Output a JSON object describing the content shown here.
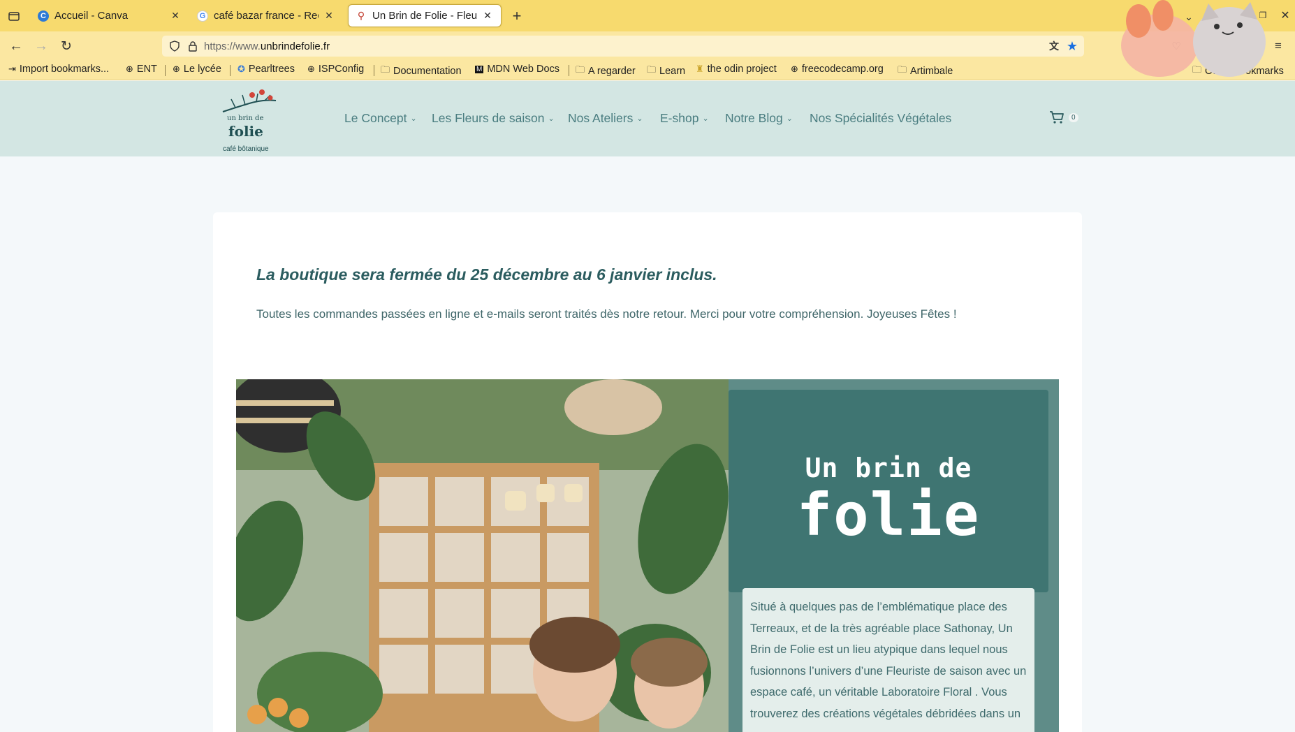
{
  "browser": {
    "tabs": [
      {
        "title": "Accueil - Canva",
        "active": false
      },
      {
        "title": "café bazar france - Recherche",
        "active": false
      },
      {
        "title": "Un Brin de Folie - Fleuriste",
        "active": true
      }
    ],
    "url_prefix": "https://www.",
    "url_domain": "unbrindefolie.fr",
    "bookmarks": [
      {
        "label": "Import bookmarks...",
        "icon": "import-icon"
      },
      {
        "label": "ENT",
        "icon": "globe-icon"
      },
      {
        "label": "Le lycée",
        "icon": "globe-icon"
      },
      {
        "label": "Pearltrees",
        "icon": "pearltrees-icon"
      },
      {
        "label": "ISPConfig",
        "icon": "globe-icon"
      },
      {
        "label": "Documentation",
        "icon": "folder-icon"
      },
      {
        "label": "MDN Web Docs",
        "icon": "mdn-icon"
      },
      {
        "label": "A regarder",
        "icon": "folder-icon"
      },
      {
        "label": "Learn",
        "icon": "folder-icon"
      },
      {
        "label": "the odin project",
        "icon": "odin-icon"
      },
      {
        "label": "freecodecamp.org",
        "icon": "globe-icon"
      },
      {
        "label": "Artimbale",
        "icon": "folder-icon"
      }
    ],
    "other_bookmarks": "Other Bookmarks"
  },
  "site": {
    "logo_top": "un brin de",
    "logo_main": "folie",
    "logo_sub": "café bôtanique",
    "menu": [
      {
        "label": "Le Concept",
        "dropdown": true
      },
      {
        "label": "Les Fleurs de saison",
        "dropdown": true
      },
      {
        "label": "Nos Ateliers",
        "dropdown": true
      },
      {
        "label": "E-shop",
        "dropdown": true
      },
      {
        "label": "Notre Blog",
        "dropdown": true
      },
      {
        "label": "Nos Spécialités Végétales",
        "dropdown": false
      }
    ],
    "cart_count": "0",
    "notice_title": "La boutique sera fermée du 25 décembre au 6 janvier inclus.",
    "notice_text": "Toutes les commandes passées en ligne et e-mails seront traités dès notre retour. Merci pour votre compréhension.  Joyeuses Fêtes !",
    "hero": {
      "brand_line1": "Un brin de",
      "brand_line2": "folie",
      "description": "Situé à quelques pas de l’emblématique place des Terreaux, et de la très agréable place Sathonay, Un Brin de Folie est un lieu atypique dans lequel nous fusionnons l’univers d’une Fleuriste de saison avec un espace café, un véritable Laboratoire Floral . Vous trouverez des créations végétales débridées dans un"
    }
  },
  "colors": {
    "tabbar": "#f7da6e",
    "header_bg": "#d3e6e3",
    "accent": "#2b5c5f",
    "menu_text": "#4a7d80"
  }
}
